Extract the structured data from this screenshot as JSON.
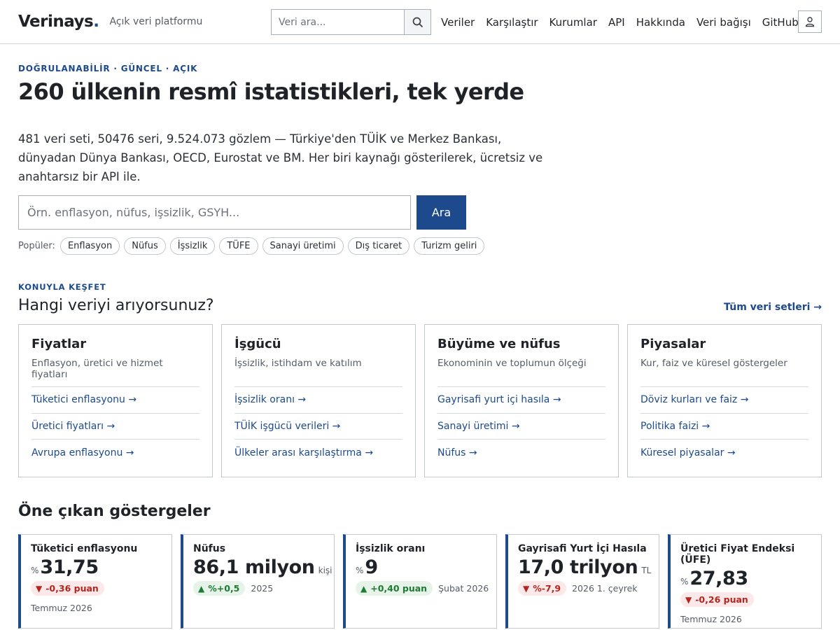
{
  "header": {
    "logo": "Verinays",
    "logo_dot": ".",
    "tagline": "Açık veri platformu",
    "search_placeholder": "Veri ara...",
    "nav": [
      "Veriler",
      "Karşılaştır",
      "Kurumlar",
      "API",
      "Hakkında",
      "Veri bağışı",
      "GitHub"
    ]
  },
  "hero": {
    "eyebrow": "DOĞRULANABİLİR · GÜNCEL · AÇIK",
    "title": "260 ülkenin resmî istatistikleri, tek yerde",
    "description": "481 veri seti, 50476 seri, 9.524.073 gözlem — Türkiye'den TÜİK ve Merkez Bankası, dünyadan Dünya Bankası, OECD, Eurostat ve BM. Her biri kaynağı gösterilerek, ücretsiz ve anahtarsız bir API ile.",
    "search_placeholder": "Örn. enflasyon, nüfus, işsizlik, GSYH...",
    "search_button": "Ara",
    "popular_label": "Popüler:",
    "popular": [
      "Enflasyon",
      "Nüfus",
      "İşsizlik",
      "TÜFE",
      "Sanayi üretimi",
      "Dış ticaret",
      "Turizm geliri"
    ]
  },
  "explore": {
    "eyebrow": "KONUYLA KEŞFET",
    "title": "Hangi veriyi arıyorsunuz?",
    "all_link": "Tüm veri setleri →",
    "cards": [
      {
        "title": "Fiyatlar",
        "subtitle": "Enflasyon, üretici ve hizmet fiyatları",
        "links": [
          "Tüketici enflasyonu →",
          "Üretici fiyatları →",
          "Avrupa enflasyonu →"
        ]
      },
      {
        "title": "İşgücü",
        "subtitle": "İşsizlik, istihdam ve katılım",
        "links": [
          "İşsizlik oranı →",
          "TÜİK işgücü verileri →",
          "Ülkeler arası karşılaştırma →"
        ]
      },
      {
        "title": "Büyüme ve nüfus",
        "subtitle": "Ekonominin ve toplumun ölçeği",
        "links": [
          "Gayrisafi yurt içi hasıla →",
          "Sanayi üretimi →",
          "Nüfus →"
        ]
      },
      {
        "title": "Piyasalar",
        "subtitle": "Kur, faiz ve küresel göstergeler",
        "links": [
          "Döviz kurları ve faiz →",
          "Politika faizi →",
          "Küresel piyasalar →"
        ]
      }
    ]
  },
  "indicators": {
    "title": "Öne çıkan göstergeler",
    "items": [
      {
        "name": "Tüketici enflasyonu",
        "prefix": "%",
        "value": "31,75",
        "unit": "",
        "change": "-0,36 puan",
        "direction": "down",
        "period_inline": "",
        "period": "Temmuz 2026"
      },
      {
        "name": "Nüfus",
        "prefix": "",
        "value": "86,1 milyon",
        "unit": "kişi",
        "change": "%+0,5",
        "direction": "up",
        "period_inline": "2025",
        "period": ""
      },
      {
        "name": "İşsizlik oranı",
        "prefix": "%",
        "value": "9",
        "unit": "",
        "change": "+0,40 puan",
        "direction": "up",
        "period_inline": "Şubat 2026",
        "period": ""
      },
      {
        "name": "Gayrisafi Yurt İçi Hasıla",
        "prefix": "",
        "value": "17,0 trilyon",
        "unit": "TL",
        "change": "%-7,9",
        "direction": "down",
        "period_inline": "2026 1. çeyrek",
        "period": ""
      },
      {
        "name": "Üretici Fiyat Endeksi (ÜFE)",
        "prefix": "%",
        "value": "27,83",
        "unit": "",
        "change": "-0,26 puan",
        "direction": "down",
        "period_inline": "",
        "period": "Temmuz 2026"
      }
    ]
  },
  "colors": {
    "accent": "#1d4a8c",
    "up": "#1e7a34",
    "down": "#b3261e"
  }
}
